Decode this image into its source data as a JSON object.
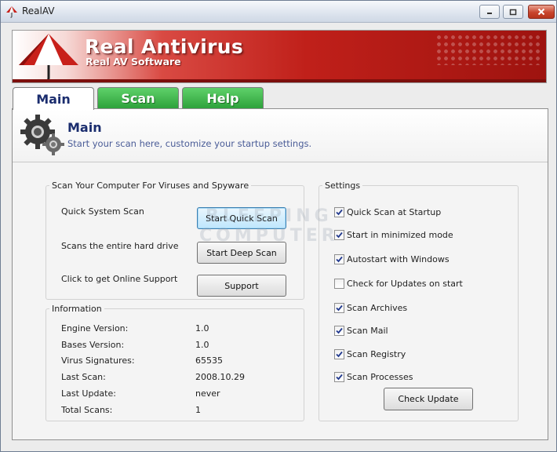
{
  "window": {
    "title": "RealAV"
  },
  "banner": {
    "title": "Real Antivirus",
    "subtitle": "Real AV Software"
  },
  "tabs": [
    {
      "label": "Main",
      "active": true
    },
    {
      "label": "Scan",
      "active": false
    },
    {
      "label": "Help",
      "active": false
    }
  ],
  "header": {
    "title": "Main",
    "subtitle": "Start your scan here, customize your startup settings."
  },
  "scan_group": {
    "legend": "Scan Your Computer For Viruses and Spyware",
    "rows": [
      {
        "label": "Quick System Scan",
        "button": "Start Quick Scan"
      },
      {
        "label": "Scans the entire hard drive",
        "button": "Start Deep Scan"
      },
      {
        "label": "Click to get Online Support",
        "button": "Support"
      }
    ]
  },
  "info_group": {
    "legend": "Information",
    "rows": [
      {
        "label": "Engine Version:",
        "value": "1.0"
      },
      {
        "label": "Bases Version:",
        "value": "1.0"
      },
      {
        "label": "Virus Signatures:",
        "value": "65535"
      },
      {
        "label": "Last Scan:",
        "value": "2008.10.29"
      },
      {
        "label": "Last Update:",
        "value": "never"
      },
      {
        "label": "Total Scans:",
        "value": "1"
      }
    ]
  },
  "settings_group": {
    "legend": "Settings",
    "options": [
      {
        "label": "Quick Scan at Startup",
        "checked": true
      },
      {
        "label": "Start in minimized mode",
        "checked": true
      },
      {
        "label": "Autostart with Windows",
        "checked": true
      },
      {
        "label": "Check for Updates on start",
        "checked": false
      },
      {
        "label": "Scan Archives",
        "checked": true
      },
      {
        "label": "Scan Mail",
        "checked": true
      },
      {
        "label": "Scan Registry",
        "checked": true
      },
      {
        "label": "Scan Processes",
        "checked": true
      }
    ],
    "button": "Check Update"
  },
  "watermark": {
    "line1": "BLEEPING",
    "line2": "COMPUTER"
  },
  "colors": {
    "accent_red": "#c0201a",
    "tab_green": "#2ea23b",
    "title_blue": "#1b2d6e"
  },
  "icons": {
    "app": "umbrella-icon",
    "header": "gears-icon"
  }
}
